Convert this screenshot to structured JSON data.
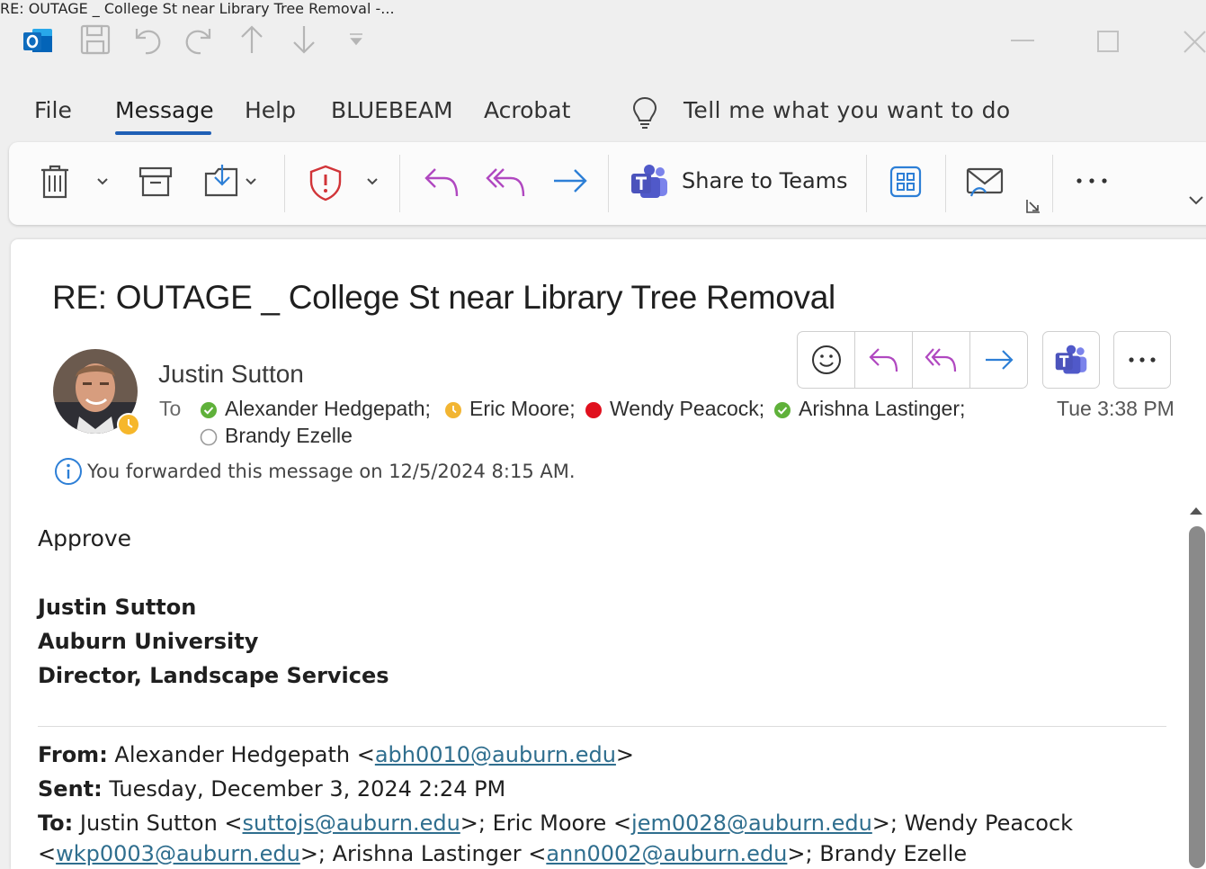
{
  "window": {
    "title": "RE: OUTAGE _ College St near Library Tree Removal -..."
  },
  "menu": {
    "file": "File",
    "message": "Message",
    "help": "Help",
    "bluebeam": "BLUEBEAM",
    "acrobat": "Acrobat",
    "tell_me": "Tell me what you want to do"
  },
  "ribbon": {
    "share_to_teams": "Share to Teams"
  },
  "email": {
    "subject": "RE: OUTAGE _ College St near Library Tree Removal",
    "sender": "Justin Sutton",
    "to_label": "To",
    "recipients": [
      {
        "name": "Alexander Hedgepath;",
        "status_color": "#5fb13a"
      },
      {
        "name": "Eric Moore;",
        "status_color": "#f2b532"
      },
      {
        "name": "Wendy Peacock;",
        "status_color": "#e0101e"
      },
      {
        "name": "Arishna Lastinger;",
        "status_color": "#5fb13a"
      },
      {
        "name": "Brandy Ezelle",
        "status_color": "#ffffff"
      }
    ],
    "timestamp": "Tue 3:38 PM",
    "info_banner": "You forwarded this message on 12/5/2024 8:15 AM.",
    "body": {
      "approve": "Approve",
      "signature": [
        "Justin Sutton",
        "Auburn University",
        "Director, Landscape Services"
      ],
      "from_label": "From:",
      "from_name": " Alexander Hedgepath <",
      "from_email": "abh0010@auburn.edu",
      "from_close": ">",
      "sent_label": "Sent:",
      "sent_value": " Tuesday, December 3, 2024 2:24 PM",
      "to_label": "To:",
      "to_part1": " Justin Sutton <",
      "to_email1": "suttojs@auburn.edu",
      "to_part2": ">; Eric Moore <",
      "to_email2": "jem0028@auburn.edu",
      "to_part3": ">; Wendy Peacock",
      "to_part4": "<",
      "to_email3": "wkp0003@auburn.edu",
      "to_part5": ">; Arishna Lastinger <",
      "to_email4": "ann0002@auburn.edu",
      "to_part6": ">; Brandy Ezelle"
    }
  },
  "colors": {
    "accent": "#1f5fb5",
    "reply_purple": "#b048c0",
    "forward_blue": "#2d7fd6",
    "link": "#2f6e8e",
    "teams": "#5059c9"
  }
}
